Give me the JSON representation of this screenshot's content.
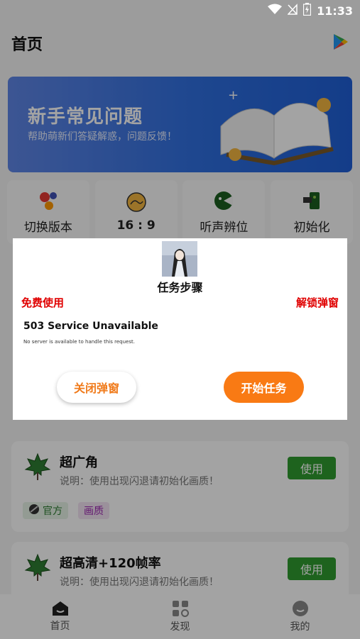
{
  "status_bar": {
    "time": "11:33"
  },
  "header": {
    "title": "首页"
  },
  "banner": {
    "title": "新手常见问题",
    "subtitle": "帮助萌新们答疑解惑，问题反馈！"
  },
  "quick_actions": [
    {
      "label": "切换版本",
      "icon": "switch-version-icon"
    },
    {
      "label": "16 : 9",
      "icon": "aspect-ratio-icon"
    },
    {
      "label": "听声辨位",
      "icon": "sound-locate-icon"
    },
    {
      "label": "初始化",
      "icon": "reset-icon"
    }
  ],
  "cards": [
    {
      "title": "超广角",
      "desc": "说明：使用出现闪退请初始化画质！",
      "button": "使用",
      "tags": [
        "官方",
        "画质"
      ]
    },
    {
      "title": "超高清+120帧率",
      "desc": "说明：使用出现闪退请初始化画质！",
      "button": "使用"
    }
  ],
  "bottom_nav": [
    {
      "label": "首页",
      "icon": "home-icon"
    },
    {
      "label": "发现",
      "icon": "discover-icon"
    },
    {
      "label": "我的",
      "icon": "profile-icon"
    }
  ],
  "dialog": {
    "title": "任务步骤",
    "left_label": "免费使用",
    "right_label": "解锁弹窗",
    "error_title": "503 Service Unavailable",
    "error_message": "No server is available to handle this request.",
    "close_button": "关闭弹窗",
    "start_button": "开始任务"
  },
  "colors": {
    "accent": "#f97a14",
    "alert_red": "#e00000",
    "use_green": "#2f9c2f",
    "banner_blue": "#2f6fe0"
  }
}
